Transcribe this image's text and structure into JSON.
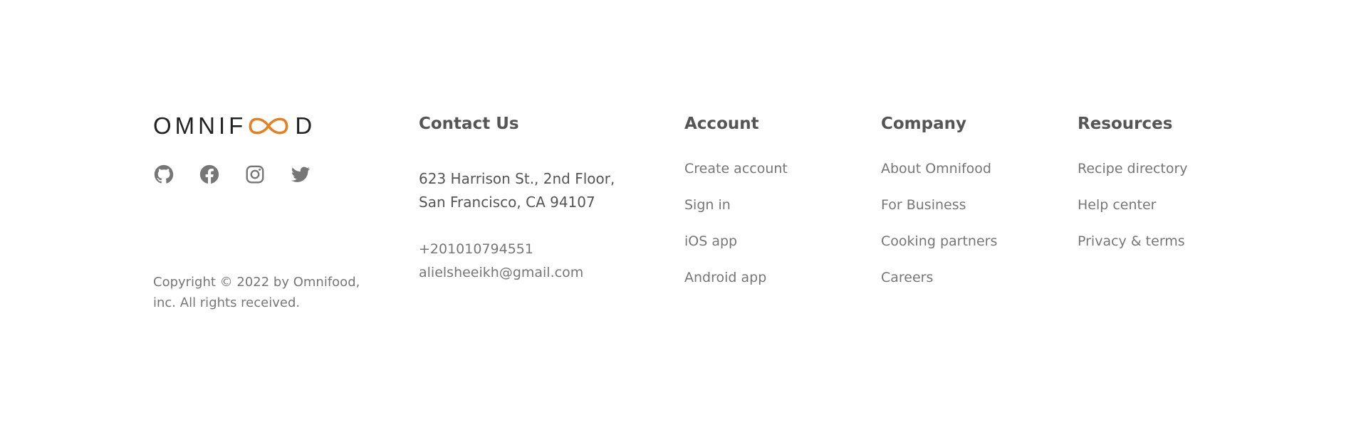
{
  "brand": {
    "logo_prefix": "OMNIF",
    "logo_suffix": "D",
    "accent_color": "#e67e22"
  },
  "social": [
    {
      "name": "github",
      "icon": "github-icon"
    },
    {
      "name": "facebook",
      "icon": "facebook-icon"
    },
    {
      "name": "instagram",
      "icon": "instagram-icon"
    },
    {
      "name": "twitter",
      "icon": "twitter-icon"
    }
  ],
  "copyright": {
    "line1": "Copyright © 2022 by Omnifood,",
    "line2": "inc. All rights received."
  },
  "contact": {
    "heading": "Contact Us",
    "address_line1": "623 Harrison St., 2nd Floor,",
    "address_line2": "San Francisco, CA 94107",
    "phone": "+201010794551",
    "email": "alielsheeikh@gmail.com"
  },
  "account": {
    "heading": "Account",
    "links": [
      "Create account",
      "Sign in",
      "iOS app",
      "Android app"
    ]
  },
  "company": {
    "heading": "Company",
    "links": [
      "About Omnifood",
      "For Business",
      "Cooking partners",
      "Careers"
    ]
  },
  "resources": {
    "heading": "Resources",
    "links": [
      "Recipe directory",
      "Help center",
      "Privacy & terms"
    ]
  }
}
